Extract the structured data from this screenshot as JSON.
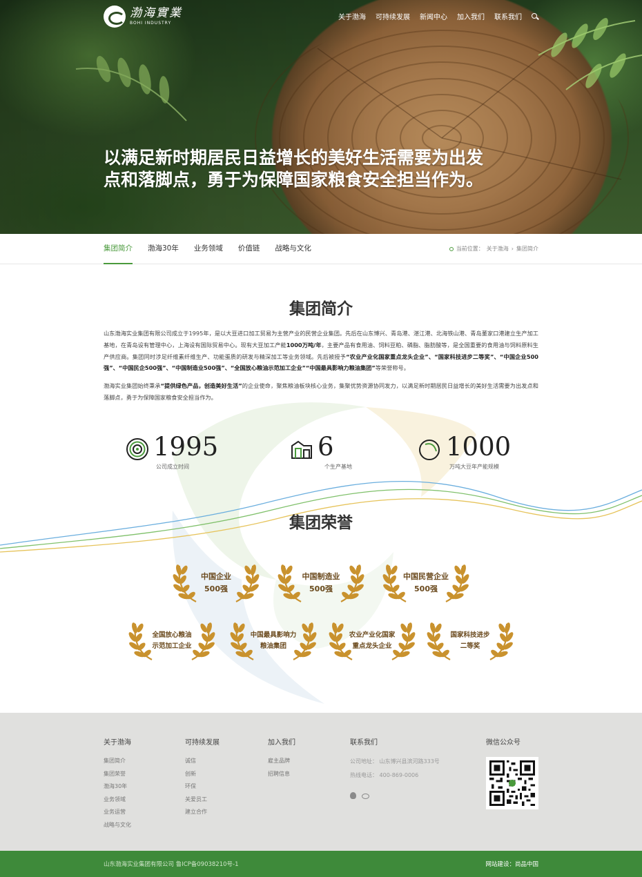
{
  "header": {
    "logo_cn": "渤海實業",
    "logo_en": "BOHI INDUSTRY",
    "nav": [
      "关于渤海",
      "可持续发展",
      "新闻中心",
      "加入我们",
      "联系我们"
    ]
  },
  "hero": {
    "slogan_line1": "以满足新时期居民日益增长的美好生活需要为出发",
    "slogan_line2": "点和落脚点，勇于为保障国家粮食安全担当作为。"
  },
  "subnav": {
    "tabs": [
      "集团简介",
      "渤海30年",
      "业务领域",
      "价值链",
      "战略与文化"
    ],
    "active": "集团简介",
    "breadcrumb_prefix": "当前位置：",
    "breadcrumb_1": "关于渤海",
    "breadcrumb_sep": "›",
    "breadcrumb_2": "集团简介"
  },
  "intro": {
    "title": "集团简介",
    "p1_a": "山东渤海实业集团有限公司成立于1995年，是以大豆进口加工贸易为主营产业的民营企业集团。先后在山东博兴、青岛港、湛江港、北海铁山港、青岛董家口港建立生产加工基地，在青岛设有管理中心，上海设有国际贸易中心。现有大豆加工产能",
    "p1_b": "1000万吨/年",
    "p1_c": "，主要产品有食用油、饲料豆粕、磷脂、脂肪酸等，是全国重要的食用油与饲料原料生产供应商。集团同时涉足纤维素纤维生产、功能蛋质的研发与精深加工等业务领域。先后被授予",
    "p1_d": "“农业产业化国家重点龙头企业”、“国家科技进步二等奖”、“中国企业500强”、“中国民企500强”、“中国制造业500强”、“全国放心粮油示范加工企业”“中国最具影响力粮油集团”",
    "p1_e": "等荣誉称号。",
    "p2_a": "渤海实业集团始终秉承",
    "p2_b": "“提供绿色产品，创造美好生活”",
    "p2_c": "的企业使命，聚焦粮油板块核心业务，集聚优势资源协同发力，以满足新时期居民日益增长的美好生活需要为出发点和落脚点，勇于为保障国家粮食安全担当作为。"
  },
  "stats": [
    {
      "num": "1995",
      "label": "公司成立时间",
      "icon": "tree-rings-icon"
    },
    {
      "num": "6",
      "label": "个生产基地",
      "icon": "factory-icon"
    },
    {
      "num": "1000",
      "label": "万吨大豆年产能规模",
      "icon": "soybean-icon"
    }
  ],
  "honors": {
    "title": "集团荣誉",
    "row1": [
      {
        "l1": "中国企业",
        "l2": "500强"
      },
      {
        "l1": "中国制造业",
        "l2": "500强"
      },
      {
        "l1": "中国民营企业",
        "l2": "500强"
      }
    ],
    "row2": [
      {
        "l1": "全国放心粮油",
        "l2": "示范加工企业"
      },
      {
        "l1": "中国最具影响力",
        "l2": "粮油集团"
      },
      {
        "l1": "农业产业化国家",
        "l2": "重点龙头企业"
      },
      {
        "l1": "国家科技进步",
        "l2": "二等奖"
      }
    ]
  },
  "footer": {
    "col1": {
      "title": "关于渤海",
      "items": [
        "集团简介",
        "集团荣誉",
        "渤海30年",
        "业务领域",
        "业务运营",
        "战略与文化"
      ]
    },
    "col2": {
      "title": "可持续发展",
      "items": [
        "诚信",
        "创新",
        "环保",
        "关爱员工",
        "建立合作"
      ]
    },
    "col3": {
      "title": "加入我们",
      "items": [
        "雇主品牌",
        "招聘信息"
      ]
    },
    "col4": {
      "title": "联系我们",
      "address": "公司地址：  山东博兴县滨河路333号",
      "phone": "热线电话：  400-869-0006"
    },
    "col5": {
      "title": "微信公众号"
    },
    "copyright": "山东渤海实业集团有限公司 鲁ICP备09038210号-1",
    "credit": "网站建设：尚品中国"
  },
  "colors": {
    "brand_green": "#4a9a3c",
    "footer_bar": "#3e8a3a",
    "laurel_gold": "#c9922e"
  }
}
